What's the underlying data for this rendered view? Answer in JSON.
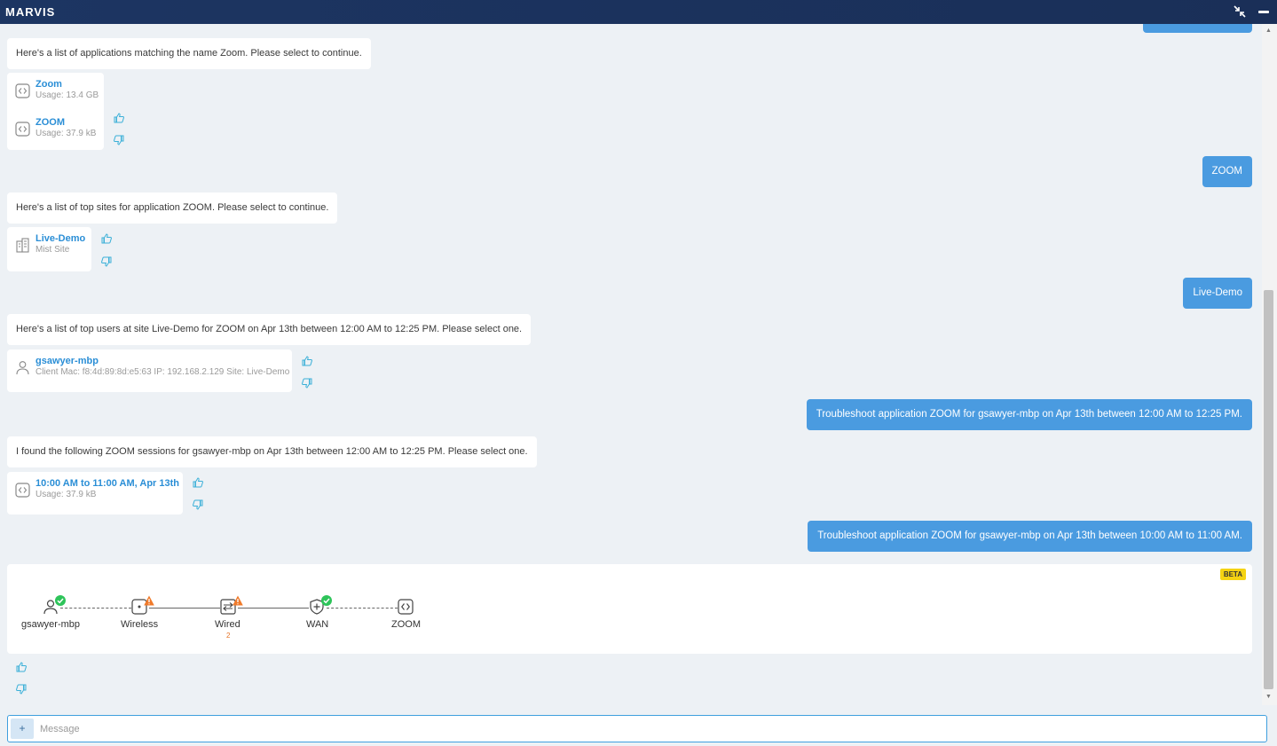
{
  "window": {
    "title": "MARVIS"
  },
  "colors": {
    "titlebar": "#1c3562",
    "accent": "#2a8ed6",
    "user_bubble": "#4a9be0",
    "thumb": "#3bb0d8",
    "ok": "#2ec45a",
    "warn": "#f07a2a",
    "beta": "#f5d312"
  },
  "messages": {
    "m1": "Here's a list of applications matching the name Zoom. Please select to continue.",
    "m1_options": [
      {
        "name": "Zoom",
        "sub": "Usage: 13.4 GB",
        "icon": "code-icon"
      },
      {
        "name": "ZOOM",
        "sub": "Usage: 37.9 kB",
        "icon": "code-icon"
      }
    ],
    "u1": "ZOOM",
    "m2": "Here's a list of top sites for application ZOOM. Please select to continue.",
    "m2_options": [
      {
        "name": "Live-Demo",
        "sub": "Mist Site",
        "icon": "building-icon"
      }
    ],
    "u2": "Live-Demo",
    "m3": "Here's a list of top users at site Live-Demo for ZOOM on Apr 13th between 12:00 AM to 12:25 PM. Please select one.",
    "m3_options": [
      {
        "name": "gsawyer-mbp",
        "sub": "Client Mac: f8:4d:89:8d:e5:63 IP: 192.168.2.129 Site: Live-Demo",
        "icon": "user-icon"
      }
    ],
    "u3": "Troubleshoot application ZOOM for gsawyer-mbp on Apr 13th between 12:00 AM to 12:25 PM.",
    "m4": "I found the following ZOOM sessions for gsawyer-mbp on Apr 13th between 12:00 AM to 12:25 PM. Please select one.",
    "m4_options": [
      {
        "name": "10:00 AM to 11:00 AM, Apr 13th",
        "sub": "Usage: 37.9 kB",
        "icon": "code-icon"
      }
    ],
    "u4": "Troubleshoot application ZOOM for gsawyer-mbp on Apr 13th between 10:00 AM to 11:00 AM."
  },
  "flow": {
    "badge": "BETA",
    "nodes": [
      {
        "label": "gsawyer-mbp",
        "icon": "user-icon",
        "status": "ok"
      },
      {
        "label": "Wireless",
        "icon": "access-point-icon",
        "status": "warn"
      },
      {
        "label": "Wired",
        "icon": "switch-icon",
        "status": "warn",
        "count": "2"
      },
      {
        "label": "WAN",
        "icon": "router-shield-icon",
        "status": "ok"
      },
      {
        "label": "ZOOM",
        "icon": "code-icon",
        "status": "none"
      }
    ]
  },
  "input": {
    "plus": "+",
    "placeholder": "Message",
    "value": ""
  }
}
